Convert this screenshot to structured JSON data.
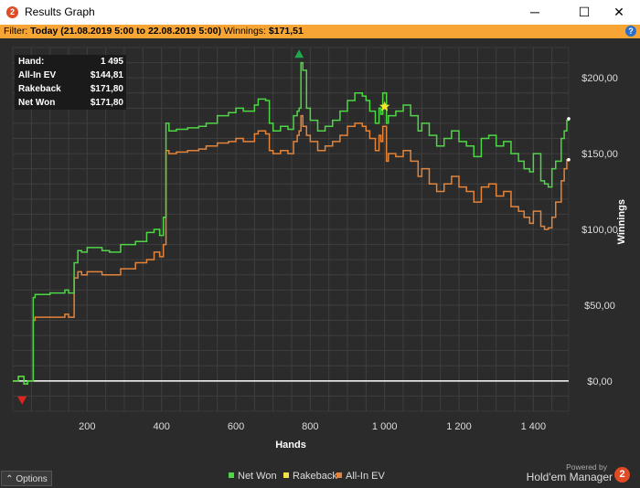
{
  "window": {
    "title": "Results Graph",
    "icon": "hm2-logo-icon",
    "minimize": "─",
    "maximize": "☐",
    "close": "✕"
  },
  "filter": {
    "label": "Filter:",
    "value": "Today (21.08.2019 5:00 to 22.08.2019 5:00)",
    "winnings_label": "Winnings:",
    "winnings_value": "$171,51",
    "help": "?"
  },
  "stats": [
    {
      "key": "Hand:",
      "value": "1 495"
    },
    {
      "key": "All-In EV",
      "value": "$144,81"
    },
    {
      "key": "Rakeback",
      "value": "$171,80"
    },
    {
      "key": "Net Won",
      "value": "$171,80"
    }
  ],
  "footer": {
    "options": "Options",
    "options_icon": "⌃",
    "powered_by": "Powered by",
    "brand": "Hold'em Manager",
    "brand_logo": "2"
  },
  "colors": {
    "net_won": "#4fd646",
    "rakeback": "#f2e24a",
    "all_in_ev": "#e3843a",
    "grid": "#3f3f3f",
    "plot_bg": "#2b2b2b",
    "zero_line": "#ffffff",
    "marker_up": "#1fa84a",
    "marker_down": "#e0231e",
    "star": "#f4e62c"
  },
  "chart_data": {
    "type": "line",
    "xlabel": "Hands",
    "ylabel": "Winnings",
    "xlim": [
      0,
      1495
    ],
    "ylim": [
      -20,
      220
    ],
    "x_ticks": [
      200,
      400,
      600,
      800,
      1000,
      1200,
      1400
    ],
    "x_tick_labels": [
      "200",
      "400",
      "600",
      "800",
      "1 000",
      "1 200",
      "1 400"
    ],
    "y_ticks": [
      0,
      50,
      100,
      150,
      200
    ],
    "y_tick_labels": [
      "$0,00",
      "$50,00",
      "$100,00",
      "$150,00",
      "$200,00"
    ],
    "grid": true,
    "legend": "bottom-center",
    "series": [
      {
        "name": "Net Won",
        "x": [
          0,
          15,
          30,
          40,
          55,
          60,
          100,
          140,
          150,
          165,
          175,
          185,
          200,
          240,
          260,
          290,
          330,
          360,
          380,
          395,
          405,
          412,
          420,
          440,
          470,
          500,
          520,
          550,
          580,
          600,
          620,
          650,
          660,
          680,
          690,
          700,
          720,
          740,
          755,
          765,
          770,
          775,
          780,
          790,
          800,
          820,
          840,
          860,
          880,
          900,
          920,
          940,
          950,
          960,
          975,
          985,
          990,
          995,
          1005,
          1010,
          1030,
          1050,
          1070,
          1090,
          1100,
          1120,
          1140,
          1160,
          1180,
          1200,
          1220,
          1240,
          1260,
          1280,
          1300,
          1320,
          1340,
          1360,
          1375,
          1390,
          1400,
          1420,
          1430,
          1440,
          1450,
          1460,
          1475,
          1483,
          1490,
          1495
        ],
        "y": [
          0,
          3,
          -2,
          0,
          55,
          57,
          58,
          60,
          58,
          78,
          86,
          85,
          88,
          86,
          85,
          90,
          92,
          98,
          100,
          96,
          108,
          170,
          165,
          166,
          167,
          168,
          170,
          175,
          177,
          180,
          178,
          182,
          186,
          185,
          170,
          165,
          168,
          166,
          175,
          178,
          180,
          210,
          205,
          180,
          172,
          165,
          168,
          172,
          178,
          185,
          190,
          188,
          185,
          178,
          170,
          180,
          176,
          190,
          170,
          175,
          178,
          182,
          175,
          165,
          170,
          162,
          155,
          160,
          165,
          158,
          155,
          148,
          160,
          162,
          155,
          158,
          150,
          145,
          140,
          138,
          150,
          132,
          130,
          128,
          140,
          145,
          160,
          165,
          172,
          173
        ]
      },
      {
        "name": "All-In EV",
        "x": [
          0,
          15,
          30,
          40,
          55,
          60,
          100,
          140,
          150,
          165,
          175,
          185,
          200,
          240,
          260,
          290,
          330,
          360,
          380,
          395,
          405,
          412,
          420,
          440,
          470,
          500,
          520,
          550,
          580,
          600,
          620,
          650,
          660,
          680,
          690,
          700,
          720,
          740,
          755,
          765,
          770,
          775,
          780,
          790,
          800,
          820,
          840,
          860,
          880,
          900,
          920,
          940,
          950,
          960,
          975,
          985,
          990,
          995,
          1005,
          1010,
          1030,
          1050,
          1070,
          1090,
          1100,
          1120,
          1140,
          1160,
          1180,
          1200,
          1220,
          1240,
          1260,
          1280,
          1300,
          1320,
          1340,
          1360,
          1375,
          1390,
          1400,
          1420,
          1430,
          1440,
          1450,
          1460,
          1475,
          1483,
          1490,
          1495
        ],
        "y": [
          0,
          3,
          -2,
          0,
          40,
          42,
          42,
          44,
          42,
          68,
          72,
          70,
          72,
          70,
          70,
          74,
          78,
          80,
          85,
          82,
          90,
          152,
          150,
          151,
          152,
          153,
          155,
          157,
          158,
          160,
          158,
          163,
          165,
          163,
          152,
          150,
          152,
          150,
          158,
          162,
          165,
          175,
          168,
          162,
          158,
          152,
          155,
          158,
          162,
          168,
          170,
          168,
          165,
          160,
          152,
          162,
          158,
          168,
          145,
          150,
          148,
          152,
          145,
          135,
          140,
          130,
          125,
          130,
          135,
          128,
          125,
          118,
          128,
          130,
          122,
          125,
          115,
          112,
          108,
          104,
          112,
          102,
          100,
          101,
          108,
          118,
          132,
          140,
          146,
          146
        ]
      }
    ],
    "markers": [
      {
        "type": "triangle-up",
        "name": "peak",
        "x": 770,
        "y": 215
      },
      {
        "type": "triangle-down",
        "name": "trough",
        "x": 25,
        "y": -12
      },
      {
        "type": "star",
        "name": "highlight",
        "x": 1000,
        "y": 181
      }
    ],
    "legend_items": [
      {
        "name": "Net Won",
        "color": "#4fd646"
      },
      {
        "name": "Rakeback",
        "color": "#f2e24a"
      },
      {
        "name": "All-In EV",
        "color": "#e3843a"
      }
    ]
  }
}
